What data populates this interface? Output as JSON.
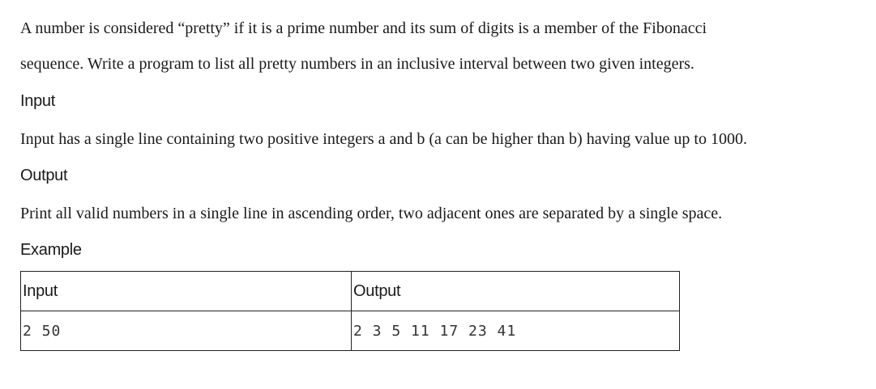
{
  "intro": "A number is considered “pretty” if it is a prime number and its sum of digits is a member of the Fibonacci sequence. Write a program to list all pretty numbers in an inclusive interval between two given integers.",
  "intro_line1": "A number is considered “pretty” if it is a prime number and its sum of digits is a member of the Fibonacci",
  "intro_line2": "sequence. Write a program to list all pretty numbers in an inclusive interval between two given integers.",
  "input_section": {
    "heading": "Input",
    "text": "Input has a single line containing two positive integers a and b (a can be higher than b) having value up to 1000."
  },
  "output_section": {
    "heading": "Output",
    "text": "Print all valid numbers in a single line in ascending order, two adjacent ones are separated by a single space."
  },
  "example_section": {
    "heading": "Example",
    "columns": [
      "Input",
      "Output"
    ],
    "rows": [
      [
        "2 50",
        "2 3 5 11 17 23 41"
      ]
    ]
  }
}
